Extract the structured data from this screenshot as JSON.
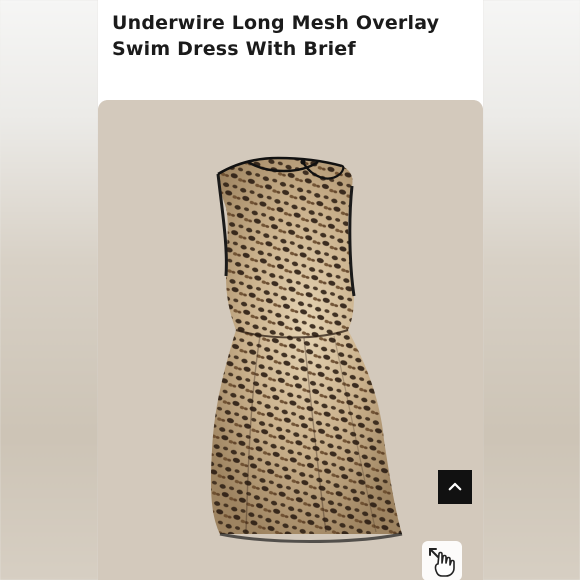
{
  "product": {
    "title": "Underwire Long Mesh Overlay Swim Dress With Brief",
    "image_alt": "Leopard print sleeveless mesh overlay swim dress"
  },
  "controls": {
    "scroll_top_icon": "chevron-up-icon",
    "zoom_icon": "pinch-zoom-hand-icon"
  },
  "colors": {
    "background": "#d3c9bc",
    "title_text": "#1b1b1b",
    "button_bg": "#111111"
  }
}
